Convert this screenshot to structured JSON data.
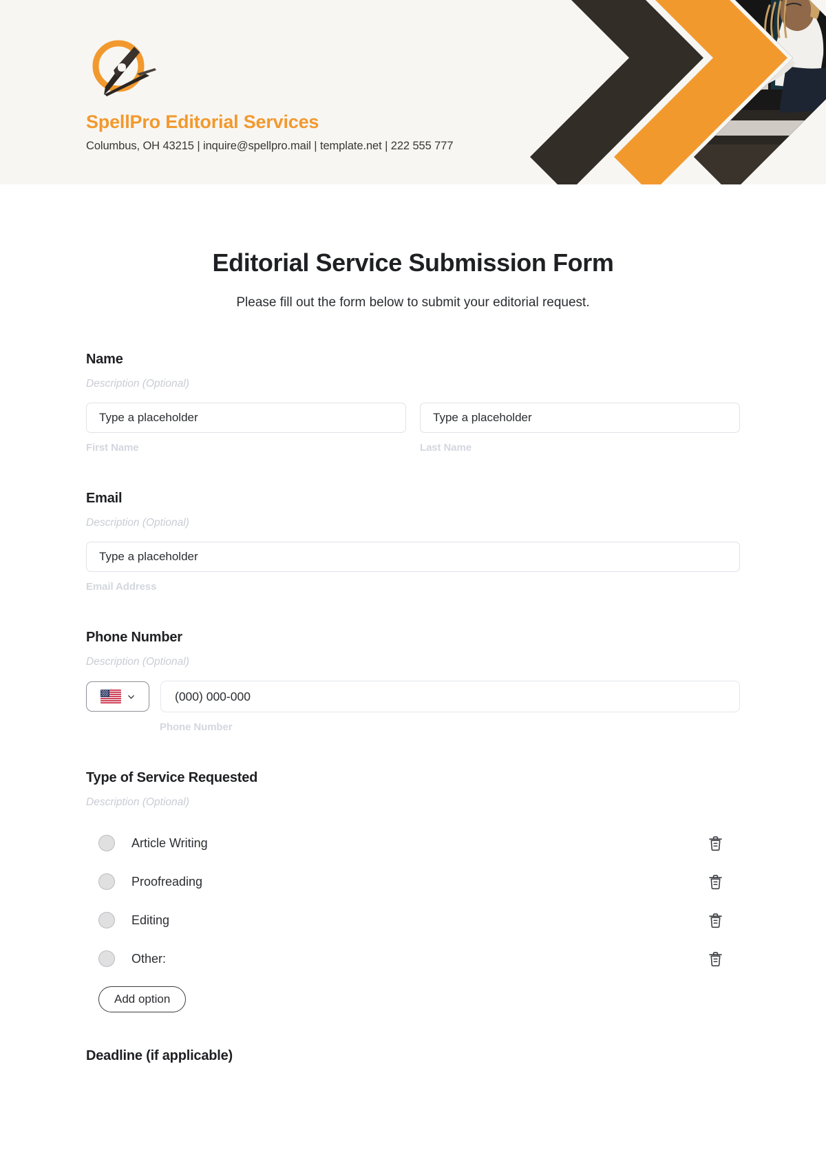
{
  "brand": {
    "name": "SpellPro Editorial Services",
    "contact": "Columbus, OH 43215 | inquire@spellpro.mail | template.net | 222 555 777",
    "logo_icon": "pen-nib-in-circle-logo",
    "accent_color": "#f2992e",
    "dark_color": "#332d27",
    "header_bg": "#f7f6f3"
  },
  "form": {
    "title": "Editorial Service Submission Form",
    "subtitle": "Please fill out the form below to submit your editorial request.",
    "description_placeholder": "Description (Optional)"
  },
  "fields": {
    "name": {
      "label": "Name",
      "description": "Description (Optional)",
      "first": {
        "placeholder": "Type a placeholder",
        "sublabel": "First Name"
      },
      "last": {
        "placeholder": "Type a placeholder",
        "sublabel": "Last Name"
      }
    },
    "email": {
      "label": "Email",
      "description": "Description (Optional)",
      "placeholder": "Type a placeholder",
      "sublabel": "Email Address"
    },
    "phone": {
      "label": "Phone Number",
      "description": "Description (Optional)",
      "country_flag": "us-flag-icon",
      "chevron": "chevron-down-icon",
      "placeholder": "(000) 000-000",
      "sublabel": "Phone Number"
    },
    "service": {
      "label": "Type of Service Requested",
      "description": "Description (Optional)",
      "options": [
        {
          "label": "Article Writing",
          "delete_icon": "trash-icon"
        },
        {
          "label": "Proofreading",
          "delete_icon": "trash-icon"
        },
        {
          "label": "Editing",
          "delete_icon": "trash-icon"
        },
        {
          "label": "Other:",
          "delete_icon": "trash-icon"
        }
      ],
      "add_option_label": "Add option"
    },
    "deadline": {
      "label": "Deadline (if applicable)"
    }
  }
}
